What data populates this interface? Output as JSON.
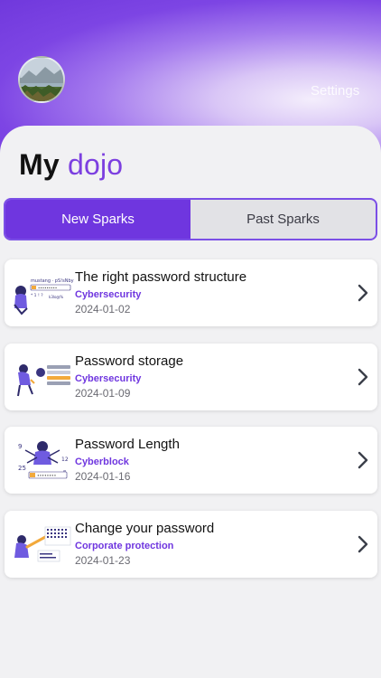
{
  "header": {
    "settings_label": "Settings"
  },
  "title": {
    "prefix": "My",
    "accent": "dojo"
  },
  "tabs": [
    {
      "label": "New Sparks",
      "active": true
    },
    {
      "label": "Past Sparks",
      "active": false
    }
  ],
  "sparks": [
    {
      "name": "The right password structure",
      "category": "Cybersecurity",
      "date": "2024-01-02"
    },
    {
      "name": "Password storage",
      "category": "Cybersecurity",
      "date": "2024-01-09"
    },
    {
      "name": "Password Length",
      "category": "Cyberblock",
      "date": "2024-01-16"
    },
    {
      "name": "Change your password",
      "category": "Corporate protection",
      "date": "2024-01-23"
    }
  ],
  "colors": {
    "accent": "#6f36df",
    "header_gradient_start": "#7038dc",
    "card_bg": "#ffffff"
  }
}
